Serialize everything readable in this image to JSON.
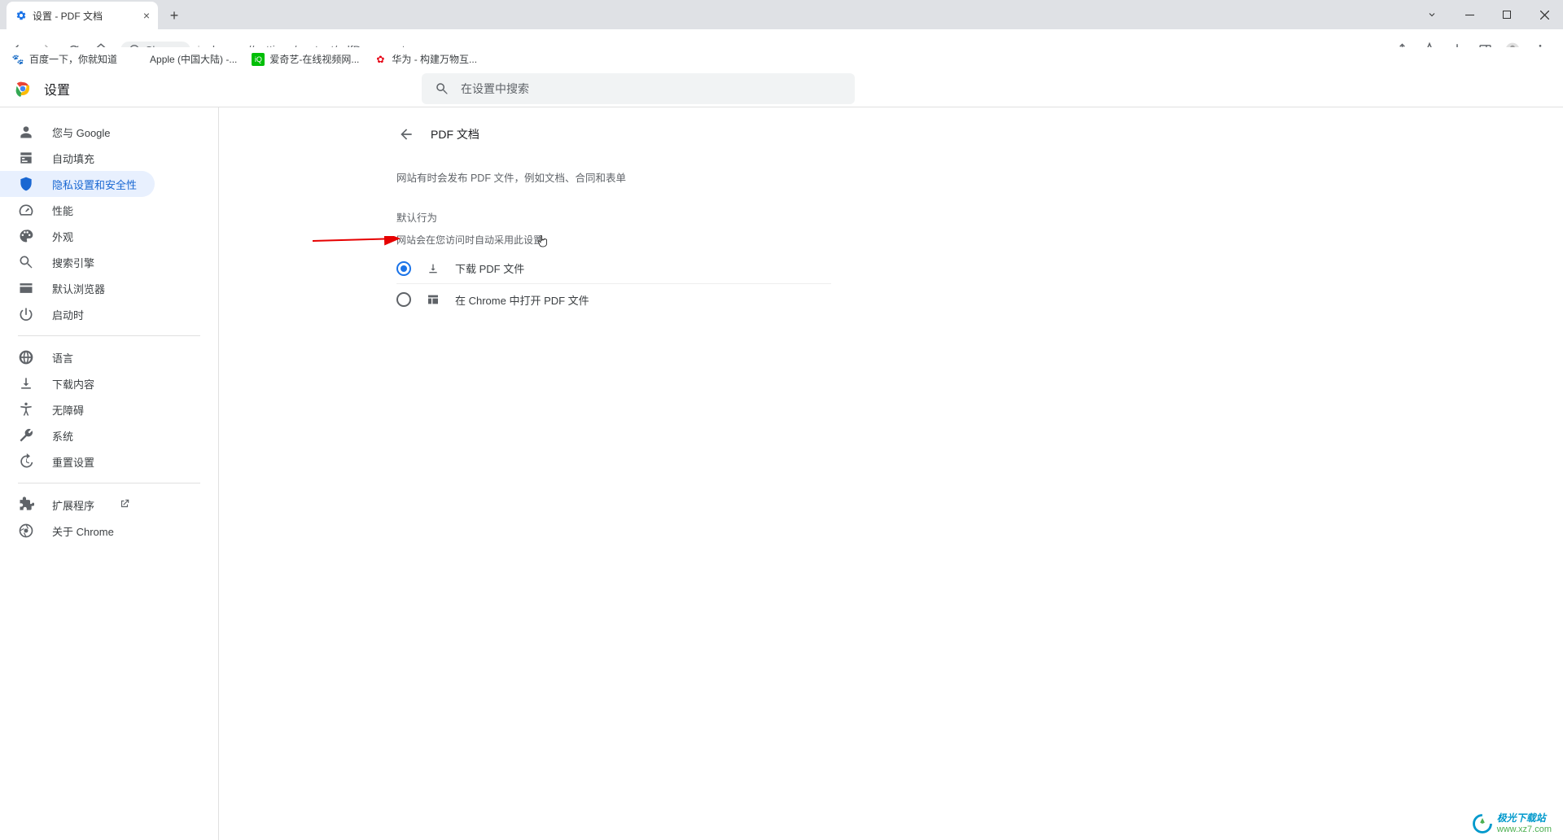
{
  "tab": {
    "title": "设置 - PDF 文档"
  },
  "address": {
    "chip_label": "Chrome",
    "url": "chrome://settings/content/pdfDocuments"
  },
  "bookmarks": [
    {
      "label": "百度一下，你就知道"
    },
    {
      "label": "Apple (中国大陆) -..."
    },
    {
      "label": "爱奇艺-在线视频网..."
    },
    {
      "label": "华为 - 构建万物互..."
    }
  ],
  "settings": {
    "title": "设置",
    "search_placeholder": "在设置中搜索",
    "sidebar": {
      "items_top": [
        {
          "label": "您与 Google"
        },
        {
          "label": "自动填充"
        },
        {
          "label": "隐私设置和安全性"
        },
        {
          "label": "性能"
        },
        {
          "label": "外观"
        },
        {
          "label": "搜索引擎"
        },
        {
          "label": "默认浏览器"
        },
        {
          "label": "启动时"
        }
      ],
      "items_mid": [
        {
          "label": "语言"
        },
        {
          "label": "下载内容"
        },
        {
          "label": "无障碍"
        },
        {
          "label": "系统"
        },
        {
          "label": "重置设置"
        }
      ],
      "items_bot": [
        {
          "label": "扩展程序"
        },
        {
          "label": "关于 Chrome"
        }
      ]
    },
    "content": {
      "page_title": "PDF 文档",
      "description": "网站有时会发布 PDF 文件，例如文档、合同和表单",
      "default_behavior_label": "默认行为",
      "default_behavior_sub": "网站会在您访问时自动采用此设置",
      "options": {
        "download": "下载 PDF 文件",
        "open_in_chrome": "在 Chrome 中打开 PDF 文件"
      }
    }
  },
  "watermark": {
    "line1": "极光下载站",
    "line2": "www.xz7.com"
  }
}
